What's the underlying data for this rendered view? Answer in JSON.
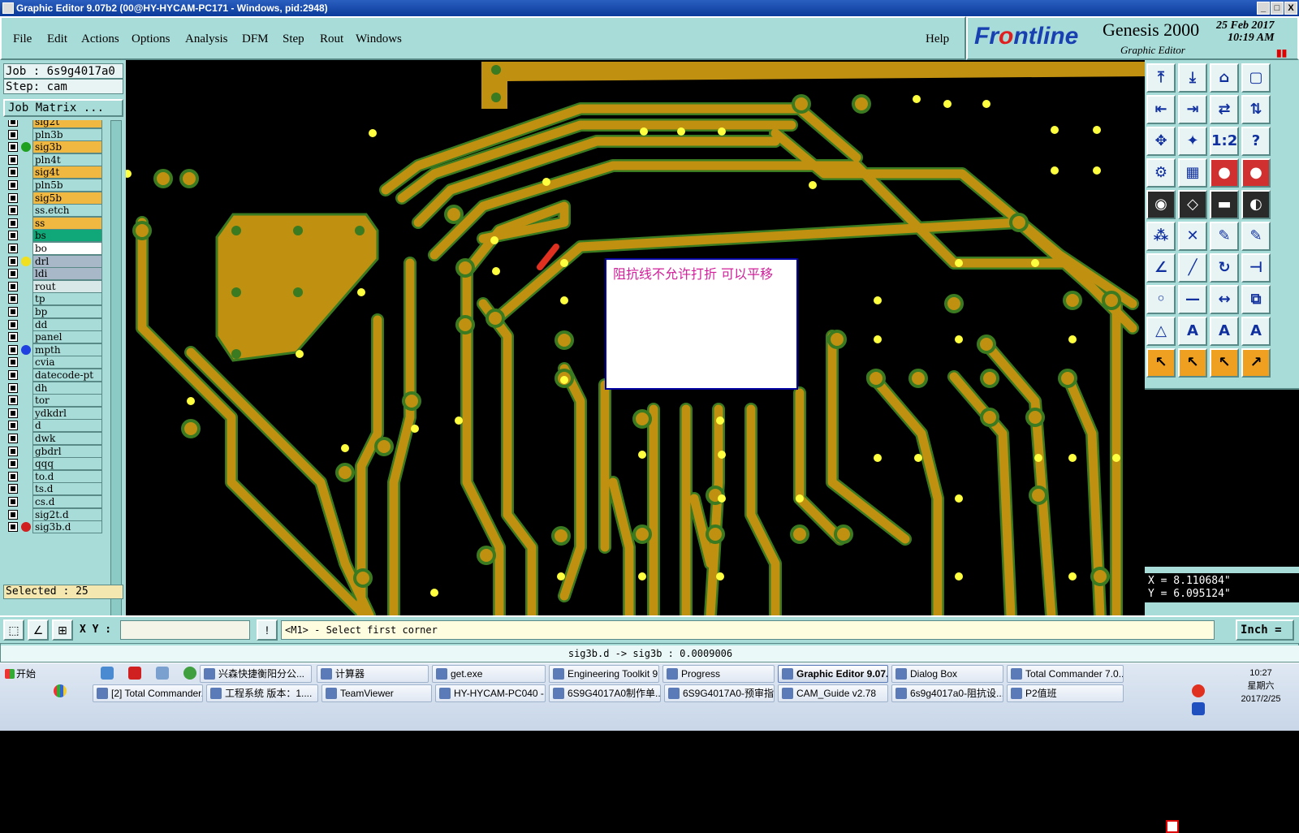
{
  "window": {
    "title": "Graphic Editor 9.07b2 (00@HY-HYCAM-PC171 - Windows, pid:2948)",
    "min_label": "_",
    "max_label": "□",
    "close_label": "X"
  },
  "menu": {
    "items": [
      "File",
      "Edit",
      "Actions",
      "Options",
      "Analysis",
      "DFM",
      "Step",
      "Rout",
      "Windows"
    ],
    "help": "Help"
  },
  "brand": {
    "logo_text_a": "Fr",
    "logo_text_b": "ntline",
    "logo_o": "o",
    "product": "Genesis 2000",
    "subtitle": "Graphic Editor",
    "date": "25 Feb 2017",
    "time": "10:19 AM"
  },
  "panel": {
    "job": "Job : 6s9g4017a0",
    "step": "Step: cam",
    "job_matrix": "Job Matrix ...",
    "selected": "Selected : 25"
  },
  "layers": [
    {
      "name": "sig2t",
      "color": "#f0b840",
      "dot": ""
    },
    {
      "name": "pln3b",
      "color": "#a8dcd8",
      "dot": ""
    },
    {
      "name": "sig3b",
      "color": "#f0b840",
      "dot": "#20a020"
    },
    {
      "name": "pln4t",
      "color": "#a8dcd8",
      "dot": ""
    },
    {
      "name": "sig4t",
      "color": "#f0b840",
      "dot": ""
    },
    {
      "name": "pln5b",
      "color": "#a8dcd8",
      "dot": ""
    },
    {
      "name": "sig5b",
      "color": "#f0b840",
      "dot": ""
    },
    {
      "name": "ss.etch",
      "color": "#a8dcd8",
      "dot": ""
    },
    {
      "name": "ss",
      "color": "#f0b840",
      "dot": ""
    },
    {
      "name": "bs",
      "color": "#10a878",
      "dot": ""
    },
    {
      "name": "bo",
      "color": "#ffffff",
      "dot": ""
    },
    {
      "name": "drl",
      "color": "#a8b8c8",
      "dot": "#f0e020"
    },
    {
      "name": "ldi",
      "color": "#a8b8c8",
      "dot": ""
    },
    {
      "name": "rout",
      "color": "#d8e8e8",
      "dot": ""
    },
    {
      "name": "tp",
      "color": "#a8dcd8",
      "dot": ""
    },
    {
      "name": "bp",
      "color": "#a8dcd8",
      "dot": ""
    },
    {
      "name": "dd",
      "color": "#a8dcd8",
      "dot": ""
    },
    {
      "name": "panel",
      "color": "#a8dcd8",
      "dot": ""
    },
    {
      "name": "mpth",
      "color": "#a8dcd8",
      "dot": "#2040e0"
    },
    {
      "name": "cvia",
      "color": "#a8dcd8",
      "dot": ""
    },
    {
      "name": "datecode-pt",
      "color": "#a8dcd8",
      "dot": ""
    },
    {
      "name": "dh",
      "color": "#a8dcd8",
      "dot": ""
    },
    {
      "name": "tor",
      "color": "#a8dcd8",
      "dot": ""
    },
    {
      "name": "ydkdrl",
      "color": "#a8dcd8",
      "dot": ""
    },
    {
      "name": "d",
      "color": "#a8dcd8",
      "dot": ""
    },
    {
      "name": "dwk",
      "color": "#a8dcd8",
      "dot": ""
    },
    {
      "name": "gbdrl",
      "color": "#a8dcd8",
      "dot": ""
    },
    {
      "name": "qqq",
      "color": "#a8dcd8",
      "dot": ""
    },
    {
      "name": "to.d",
      "color": "#a8dcd8",
      "dot": ""
    },
    {
      "name": "ts.d",
      "color": "#a8dcd8",
      "dot": ""
    },
    {
      "name": "cs.d",
      "color": "#a8dcd8",
      "dot": ""
    },
    {
      "name": "sig2t.d",
      "color": "#a8dcd8",
      "dot": ""
    },
    {
      "name": "sig3b.d",
      "color": "#a8dcd8",
      "dot": "#d02020"
    }
  ],
  "note": {
    "text": "阻抗线不允许打折   可以平移"
  },
  "toolbar": {
    "buttons": [
      "⤒",
      "⤓",
      "⌂",
      "▢",
      "⇤",
      "⇥",
      "⇄",
      "⇅",
      "✥",
      "✦",
      "1:2",
      "?",
      "⚙",
      "▦",
      "●",
      "●",
      "◉",
      "◇",
      "▬",
      "◐",
      "⁂",
      "✕",
      "✎",
      "✎",
      "∠",
      "╱",
      "↻",
      "⊣",
      "◦",
      "—",
      "↔",
      "⧉",
      "△",
      "A",
      "A",
      "A",
      "↖",
      "↖",
      "↖",
      "↗"
    ]
  },
  "coords": {
    "x": "X =  8.110684\"",
    "y": "Y =  6.095124\""
  },
  "command": {
    "xy_label": "X Y :",
    "xy_value": "",
    "prompt": "<M1> - Select first corner",
    "units": "Inch ="
  },
  "status": {
    "text": "sig3b.d -> sig3b : 0.0009006"
  },
  "taskbar": {
    "start": "开始",
    "row1": [
      "兴森快捷衡阳分公...",
      "计算器",
      "get.exe",
      "Engineering Toolkit 9....",
      "Progress",
      "Graphic Editor 9.07...",
      "Dialog Box",
      "Total Commander 7.0..."
    ],
    "row2": [
      "[2] Total Commander...",
      "工程系统  版本：1....",
      "TeamViewer",
      "HY-HYCAM-PC040 - T...",
      "6S9G4017A0制作单....",
      "6S9G4017A0-预审指...",
      "CAM_Guide v2.78",
      "6s9g4017a0-阻抗设...",
      "P2值班"
    ],
    "time": "10:27",
    "weekday": "星期六",
    "date": "2017/2/25"
  }
}
